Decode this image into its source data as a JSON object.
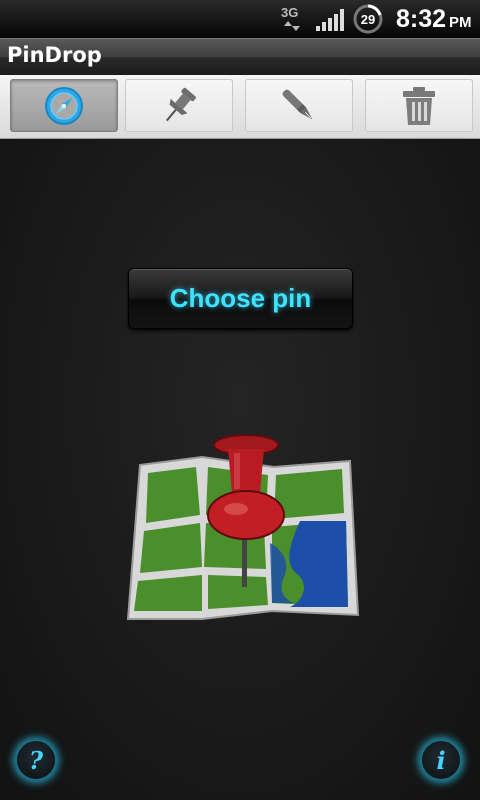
{
  "status_bar": {
    "network_type": "3G",
    "battery_level": "29",
    "time": "8:32",
    "ampm": "PM"
  },
  "app": {
    "title": "PinDrop"
  },
  "toolbar": {
    "tabs": [
      {
        "icon": "compass-icon",
        "active": true
      },
      {
        "icon": "pushpin-icon",
        "active": false
      },
      {
        "icon": "pen-icon",
        "active": false
      },
      {
        "icon": "trash-icon",
        "active": false
      }
    ]
  },
  "main": {
    "choose_pin_label": "Choose pin",
    "illustration": "map-with-pushpin-icon"
  },
  "bottom": {
    "help_label": "?",
    "info_label": "i"
  },
  "colors": {
    "accent": "#3fe3ff",
    "compass_blue": "#2aa8e8",
    "pin_red": "#c21f24",
    "map_green": "#4a8f2c",
    "water_blue": "#1c4fa8"
  }
}
